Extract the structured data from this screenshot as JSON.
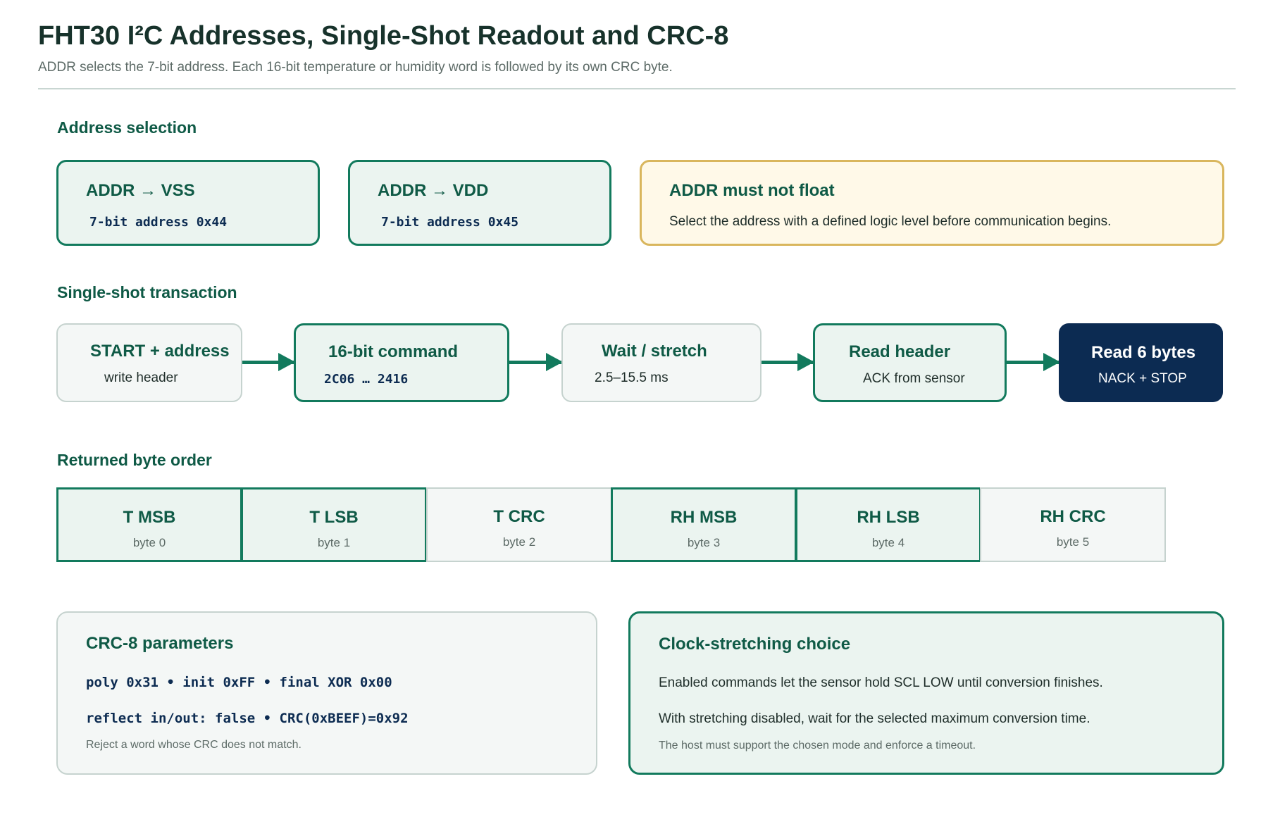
{
  "header": {
    "title": "FHT30 I²C Addresses, Single-Shot Readout and CRC-8",
    "subtitle": "ADDR selects the 7-bit address. Each 16-bit temperature or humidity word is followed by its own CRC byte."
  },
  "address_selection": {
    "heading": "Address selection",
    "vss": {
      "title": "ADDR → VSS",
      "detail": "7-bit address 0x44"
    },
    "vdd": {
      "title": "ADDR → VDD",
      "detail": "7-bit address 0x45"
    },
    "float": {
      "title": "ADDR must not float",
      "detail": "Select the address with a defined logic level before communication begins."
    }
  },
  "transaction": {
    "heading": "Single-shot transaction",
    "steps": [
      {
        "title": "START + address",
        "detail": "write header"
      },
      {
        "title": "16-bit command",
        "detail": "2C06 … 2416"
      },
      {
        "title": "Wait / stretch",
        "detail": "2.5–15.5 ms"
      },
      {
        "title": "Read header",
        "detail": "ACK from sensor"
      },
      {
        "title": "Read 6 bytes",
        "detail": "NACK + STOP"
      }
    ]
  },
  "byte_order": {
    "heading": "Returned byte order",
    "bytes": [
      {
        "name": "T MSB",
        "index": "byte 0"
      },
      {
        "name": "T LSB",
        "index": "byte 1"
      },
      {
        "name": "T CRC",
        "index": "byte 2"
      },
      {
        "name": "RH MSB",
        "index": "byte 3"
      },
      {
        "name": "RH LSB",
        "index": "byte 4"
      },
      {
        "name": "RH CRC",
        "index": "byte 5"
      }
    ]
  },
  "crc_panel": {
    "title": "CRC-8 parameters",
    "line1": "poly 0x31 • init 0xFF • final XOR 0x00",
    "line2": "reflect in/out: false • CRC(0xBEEF)=0x92",
    "note": "Reject a word whose CRC does not match."
  },
  "stretch_panel": {
    "title": "Clock-stretching choice",
    "line1": "Enabled commands let the sensor hold SCL LOW until conversion finishes.",
    "line2": "With stretching disabled, wait for the selected maximum conversion time.",
    "note": "The host must support the chosen mode and enforce a timeout."
  }
}
